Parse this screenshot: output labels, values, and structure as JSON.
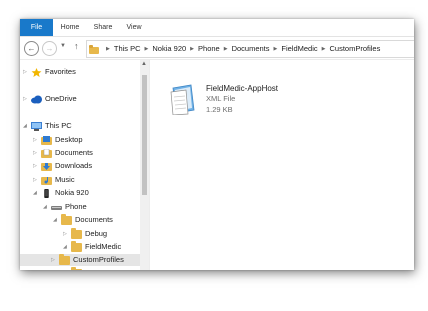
{
  "ribbon": {
    "tabs": [
      {
        "label": "File"
      },
      {
        "label": "Home"
      },
      {
        "label": "Share"
      },
      {
        "label": "View"
      }
    ]
  },
  "address": {
    "crumbs": [
      "This PC",
      "Nokia 920",
      "Phone",
      "Documents",
      "FieldMedic",
      "CustomProfiles"
    ]
  },
  "nav": {
    "favorites": "Favorites",
    "onedrive": "OneDrive",
    "thispc": "This PC",
    "desktop": "Desktop",
    "documents": "Documents",
    "downloads": "Downloads",
    "music": "Music",
    "nokia": "Nokia 920",
    "phone": "Phone",
    "phone_documents": "Documents",
    "debug": "Debug",
    "fieldmedic": "FieldMedic",
    "customprofiles": "CustomProfiles"
  },
  "content": {
    "file": {
      "name": "FieldMedic-AppHost",
      "type": "XML File",
      "size": "1.29 KB"
    }
  },
  "colors": {
    "file_tab": "#1979ca",
    "folder": "#e7b84b",
    "selected_row": "#e5e5e5"
  }
}
